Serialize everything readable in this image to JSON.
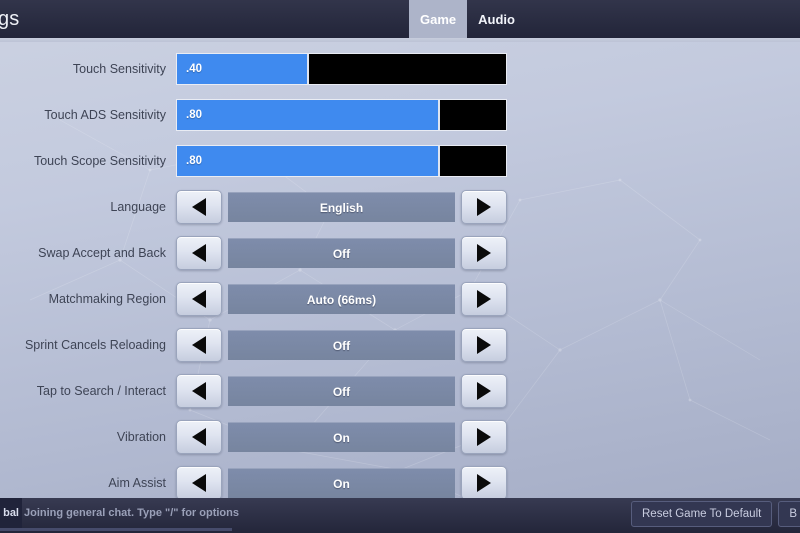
{
  "topbar": {
    "title": "ings",
    "tabs": [
      {
        "label": "Game",
        "active": true
      },
      {
        "label": "Audio",
        "active": false
      }
    ]
  },
  "settings": {
    "rows": [
      {
        "type": "slider",
        "label": "Touch Sensitivity",
        "value": ".40",
        "fill_percent": 40
      },
      {
        "type": "slider",
        "label": "Touch ADS Sensitivity",
        "value": ".80",
        "fill_percent": 80
      },
      {
        "type": "slider",
        "label": "Touch Scope Sensitivity",
        "value": ".80",
        "fill_percent": 80
      },
      {
        "type": "selector",
        "label": "Language",
        "value": "English"
      },
      {
        "type": "selector",
        "label": "Swap Accept and Back",
        "value": "Off"
      },
      {
        "type": "selector",
        "label": "Matchmaking Region",
        "value": "Auto (66ms)"
      },
      {
        "type": "selector",
        "label": "Sprint Cancels Reloading",
        "value": "Off"
      },
      {
        "type": "selector",
        "label": "Tap to Search / Interact",
        "value": "Off"
      },
      {
        "type": "selector",
        "label": "Vibration",
        "value": "On"
      },
      {
        "type": "selector",
        "label": "Aim Assist",
        "value": "On"
      }
    ],
    "arrow_left_icon": "triangle-left-icon",
    "arrow_right_icon": "triangle-right-icon"
  },
  "bottombar": {
    "chat_tab_label": "bal",
    "chat_message": "Joining general chat. Type \"/\" for options",
    "buttons": [
      {
        "label": "Reset Game To Default"
      },
      {
        "label": "B"
      }
    ]
  },
  "colors": {
    "accent_blue": "#3f8aef",
    "topbar_dark": "#272a41",
    "bottombar_dark": "#2b2e47",
    "value_box": "#7e8cab",
    "tab_active_bg": "#adb4c9",
    "label_text": "#3e4455"
  }
}
